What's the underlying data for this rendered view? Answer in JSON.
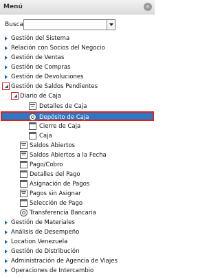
{
  "header": {
    "title": "Menú",
    "collapse_icon": "collapse-icon"
  },
  "search": {
    "label": "Buscar:",
    "value": ""
  },
  "menu": {
    "gestion_sistema": "Gestión del Sistema",
    "relacion_socios": "Relación con Socios del Negocio",
    "gestion_ventas": "Gestión de Ventas",
    "gestion_compras": "Gestión de Compras",
    "gestion_devoluciones": "Gestión de Devoluciones",
    "gestion_saldos": "Gestión de Saldos Pendientes",
    "diario_caja": "Diario de Caja",
    "detalles_caja": "Detalles de Caja",
    "deposito_caja": "Depósito de Caja",
    "cierre_caja": "Cierre de Caja",
    "caja": "Caja",
    "saldos_abiertos": "Saldos Abiertos",
    "saldos_abiertos_fecha": "Saldos Abiertos a la Fecha",
    "pago_cobro": "Pago/Cobro",
    "detalles_pago": "Detalles del Pago",
    "asignacion_pagos": "Asignación de Pagos",
    "pagos_sin_asignar": "Pagos sin Asignar",
    "seleccion_pago": "Selección de Pago",
    "transferencia_bancaria": "Transferencia Bancaria",
    "gestion_materiales": "Gestión de Materiales",
    "analisis_desempeno": "Análisis de Desempeño",
    "location_venezuela": "Location Venezuela",
    "gestion_distribucion": "Gestión de Distribución",
    "admin_agencia_viajes": "Administración de Agencia de Viajes",
    "operaciones_intercambio": "Operaciones de Intercambio"
  },
  "colors": {
    "selection": "#2b79c6",
    "highlight_border": "#e02020",
    "tree_arrow": "#1d5fae"
  }
}
